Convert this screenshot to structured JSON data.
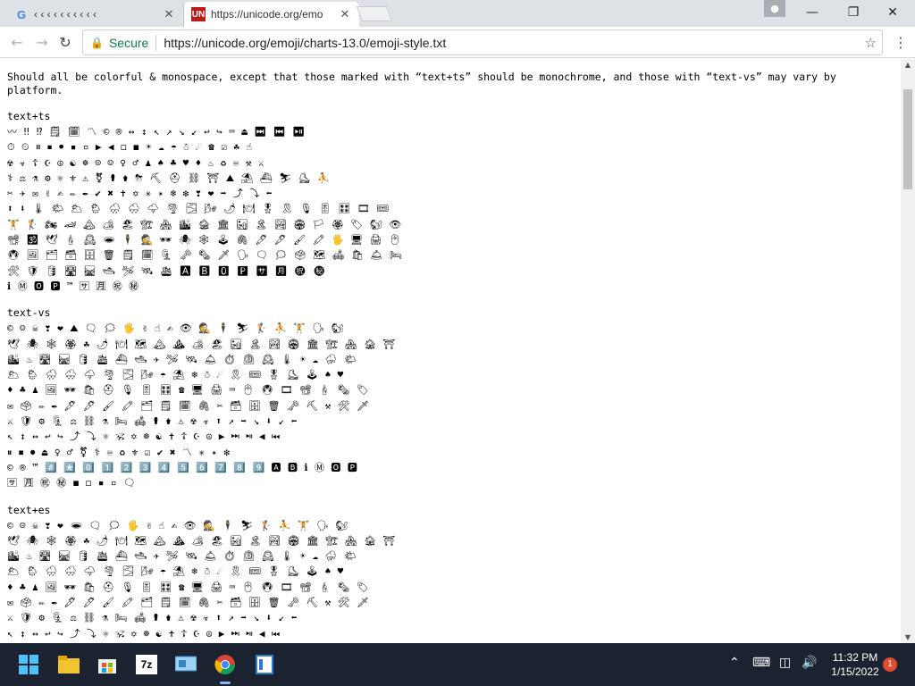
{
  "browser": {
    "tabs": [
      {
        "title": "‹ ‹ ‹ ‹ ‹ ‹ ‹ ‹ ‹ ‹",
        "favicon": "G",
        "active": false
      },
      {
        "title": "https://unicode.org/emo",
        "favicon": "UN",
        "active": true
      }
    ],
    "close_glyph": "✕",
    "secure_label": "Secure",
    "url": "https://unicode.org/emoji/charts-13.0/emoji-style.txt",
    "window": {
      "minimize": "—",
      "maximize": "❐",
      "close": "✕"
    }
  },
  "page": {
    "intro": "Should all be colorful & monospace, except that those marked with “text+ts” should be monochrome, and those with “text-vs” may vary by platform.",
    "sections": [
      {
        "heading": "text+ts",
        "rows": [
          "〰 ‼ ⁉ 🗒 🗓 〽 © ® ↔ ↕ ↖ ↗ ↘ ↙ ↩ ↪ ⌨ ⏏ ⏭ ⏮ ⏯",
          "⏱ ⏲ ⏸ ⏹ ⏺ ▪ ▫ ▶ ◀ ◻ ◼ ☀ ☁ ☂ ☃ ☄ ☎ ☑ ☘ ☝",
          "☢ ☣ ☦ ☪ ☮ ☯ ☸ ☹ ☺ ♀ ♂ ♟ ♠ ♣ ♥ ♦ ♨ ♻ ♾ ⚒ ⚔",
          "⚕ ⚖ ⚗ ⚙ ⚛ ⚜ ⚠ ⚧ ⚰ ⚱ ⛈ ⛏ ⛑ ⛓ ⛩ ⛰ ⛱ ⛴ ⛷ ⛸ ⛹",
          "✂ ✈ ✉ ✌ ✍ ✏ ✒ ✔ ✖ ✝ ✡ ✳ ✴ ❄ ❇ ❣ ❤ ➡ ⤴ ⤵ ⬅",
          "⬆ ⬇ 🌡 🌤 🌥 🌦 🌧 🌨 🌩 🌪 🌫 🌬 🌶 🍽 🎖 🎗 🎙 🎚 🎛 🎞 🎟",
          "🏋 🏌 🏍 🏎 🏔 🏕 🏖 🏗 🏘 🏙 🏚 🏛 🏜 🏝 🏞 🏟 🏳 🏵 🏷 🐿 👁",
          "📽 🕉 🕊 🕯 🕰 🕳 🕴 🕵 🕶 🕷 🕸 🕹 🖇 🖊 🖋 🖌 🖍 🖐 🖥 🖨 🖱",
          "🖲 🖼 🗂 🗃 🗄 🗑 🗒 🗓 🗜 🗝 🗞 🗡 🗣 🗨 🗯 🗳 🗺 🛋 🛍 🛎 🛏",
          "🛠 🛡 🛢 🛣 🛤 🛥 🛩 🛰 🛳 🅰 🅱 🅾 🅿 🈂 🈷 ㊗ ㊙",
          "ℹ Ⓜ 🅾 🅿 ™ 🈂 🈷 ㊗ ㊙"
        ]
      },
      {
        "heading": "text-vs",
        "rows": [
          "© ☺ ☠ ❣ ❤ ⛰ 🗨 🗯 🖐 ✌ ☝ ✍ 👁 🕵 🕴 ⛷ 🏌 ⛹ 🏋 🗣 🐿",
          "🕊 🕷 🕸 🏵 ☘ 🌶 🍽 🗺 🏔 ⛰ 🏕 🏖 🏜 🏝 🏞 🏟 🏛 🏗 🏘 🏚 ⛩",
          "🏙 ♨ 🛣 🛤 🛢 🛳 ⛴ 🛥 ✈ 🛩 🛰 🛎 ⏱ ⏲ 🕰 🌡 ☀ ☁ ⛈ 🌤",
          "🌥 🌦 🌧 🌨 🌩 🌪 🌫 🌬 ☂ ⛱ ❄ ☃ ☄ 🎗 🎟 🎖 ⛸ 🕹 ♠ ♥",
          "♦ ♣ ♟ 🖼 🕶 🛍 ⛑ 🎙 🎚 🎛 ☎ 🖥 🖨 ⌨ 🖱 🖲 🎞 📽 🕯 🗞 🏷",
          "✉ 🗳 ✏ ✒ 🖋 🖊 🖌 🖍 🗂 🗒 🗓 🖇 ✂ 🗃 🗄 🗑 🗝 ⛏ ⚒ 🛠 🗡",
          "⚔ 🛡 ⚙ 🗜 ⚖ ⛓ ⚗ 🛏 🛋 ⚰ ⚱ ⚠ ☢ ☣ ⬆ ↗ ➡ ↘ ⬇ ↙ ⬅",
          "↖ ↕ ↔ ↩ ↪ ⤴ ⤵ ⚛ 🕉 ✡ ☸ ☯ ✝ ☦ ☪ ☮ ▶ ⏭ ⏯ ◀ ⏮",
          "⏸ ⏹ ⏺ ⏏ ♀ ♂ ⚧ ⚕ ♾ ♻ ⚜ ☑ ✔ ✖ 〽 ✳ ✴ ❇",
          "© ® ™ #️⃣ *️⃣ 0️⃣ 1️⃣ 2️⃣ 3️⃣ 4️⃣ 5️⃣ 6️⃣ 7️⃣ 8️⃣ 9️⃣ 🅰 🅱 ℹ Ⓜ 🅾 🅿",
          "🈂 🈷 ㊗ ㊙ ◼ ◻ ▪ ▫ 🗨"
        ]
      },
      {
        "heading": "text+es",
        "rows": [
          "© ☹ ☠ ❣ ❤ 🕳 🗨 🗯 🖐 ✌ ☝ ✍ 👁 🕵 🕴 ⛷ 🏌 ⛹ 🏋 🗣 🐿",
          "🕊 🕷 🕸 🏵 ☘ 🌶 🍽 🗺 🏔 ⛰ 🏕 🏖 🏜 🏝 🏞 🏟 🏛 🏗 🏘 🏚 ⛩",
          "🏙 ♨ 🛣 🛤 🛢 🛳 ⛴ 🛥 ✈ 🛩 🛰 🛎 ⏱ ⏲ 🕰 🌡 ☀ ☁ ⛈ 🌤",
          "🌥 🌦 🌧 🌨 🌩 🌪 🌫 🌬 ☂ ⛱ ❄ ☃ ☄ 🎗 🎟 🎖 ⛸ 🕹 ♠ ♥",
          "♦ ♣ ♟ 🖼 🕶 🛍 ⛑ 🎙 🎚 🎛 ☎ 🖥 🖨 ⌨ 🖱 🖲 🎞 📽 🕯 🗞 🏷",
          "✉ 🗳 ✏ ✒ 🖋 🖊 🖌 🖍 🗂 🗒 🗓 🖇 ✂ 🗃 🗄 🗑 🗝 ⛏ ⚒ 🛠 🗡",
          "⚔ 🛡 ⚙ 🗜 ⚖ ⛓ ⚗ 🛏 🛋 ⚰ ⚱ ⚠ ☢ ☣ ⬆ ↗ ➡ ↘ ⬇ ↙ ⬅",
          "↖ ↕ ↔ ↩ ↪ ⤴ ⤵ ⚛ 🕉 ✡ ☸ ☯ ✝ ☦ ☪ ☮ ▶ ⏭ ⏯ ◀ ⏮"
        ]
      }
    ]
  },
  "taskbar": {
    "time": "11:32 PM",
    "date": "1/15/2022",
    "notifications": "1",
    "apps": [
      "start-icon",
      "file-explorer-icon",
      "store-icon",
      "7zip-icon",
      "control-panel-icon",
      "chrome-icon",
      "notepad-icon"
    ]
  },
  "colors": {
    "secure": "#0b8043",
    "taskbar": "#1c2330",
    "tabbar": "#dee1e6"
  }
}
